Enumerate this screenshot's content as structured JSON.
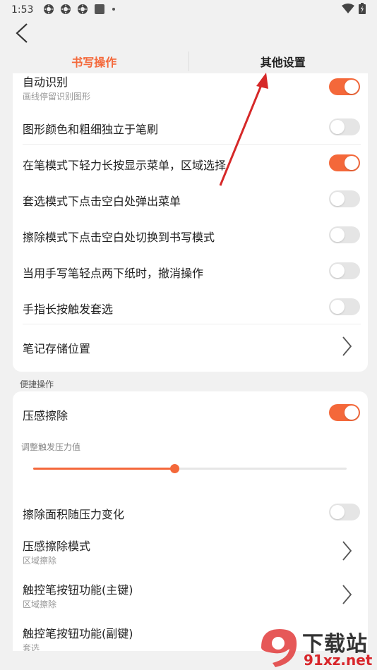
{
  "status_bar": {
    "time": "1:53",
    "icons": [
      "settings-icon",
      "settings-icon",
      "settings-icon",
      "square-icon",
      "dot-icon"
    ],
    "right_icons": [
      "wifi-icon",
      "battery-icon"
    ]
  },
  "tabs": [
    {
      "label": "书写操作",
      "active": true
    },
    {
      "label": "其他设置",
      "active": false
    }
  ],
  "card1": {
    "auto_recognize": {
      "label": "自动识别",
      "sub": "画线停留识别图形",
      "on": true
    },
    "rows": [
      {
        "label": "图形颜色和粗细独立于笔刷",
        "on": false
      },
      {
        "label": "在笔模式下轻力长按显示菜单，区域选择",
        "on": true
      },
      {
        "label": "套选模式下点击空白处弹出菜单",
        "on": false
      },
      {
        "label": "擦除模式下点击空白处切换到书写模式",
        "on": false
      },
      {
        "label": "当用手写笔轻点两下纸时，撤消操作",
        "on": false
      },
      {
        "label": "手指长按触发套选",
        "on": false
      }
    ],
    "storage": {
      "label": "笔记存储位置"
    }
  },
  "section2_title": "便捷操作",
  "card2": {
    "pressure_erase": {
      "label": "压感擦除",
      "on": true
    },
    "threshold": {
      "label": "调整触发压力值",
      "value": 0.45
    },
    "area_pressure": {
      "label": "擦除面积随压力变化",
      "on": false
    },
    "erase_mode": {
      "label": "压感擦除模式",
      "sub": "区域擦除"
    },
    "primary_btn": {
      "label": "触控笔按钮功能(主键)",
      "sub": "区域擦除"
    },
    "secondary_btn": {
      "label": "触控笔按钮功能(副键)",
      "sub": "套选"
    }
  },
  "watermark": {
    "text1": "下载站",
    "text2": "91xz.net",
    "logo": "9"
  },
  "colors": {
    "accent": "#f4683a",
    "arrow": "#d62828"
  }
}
